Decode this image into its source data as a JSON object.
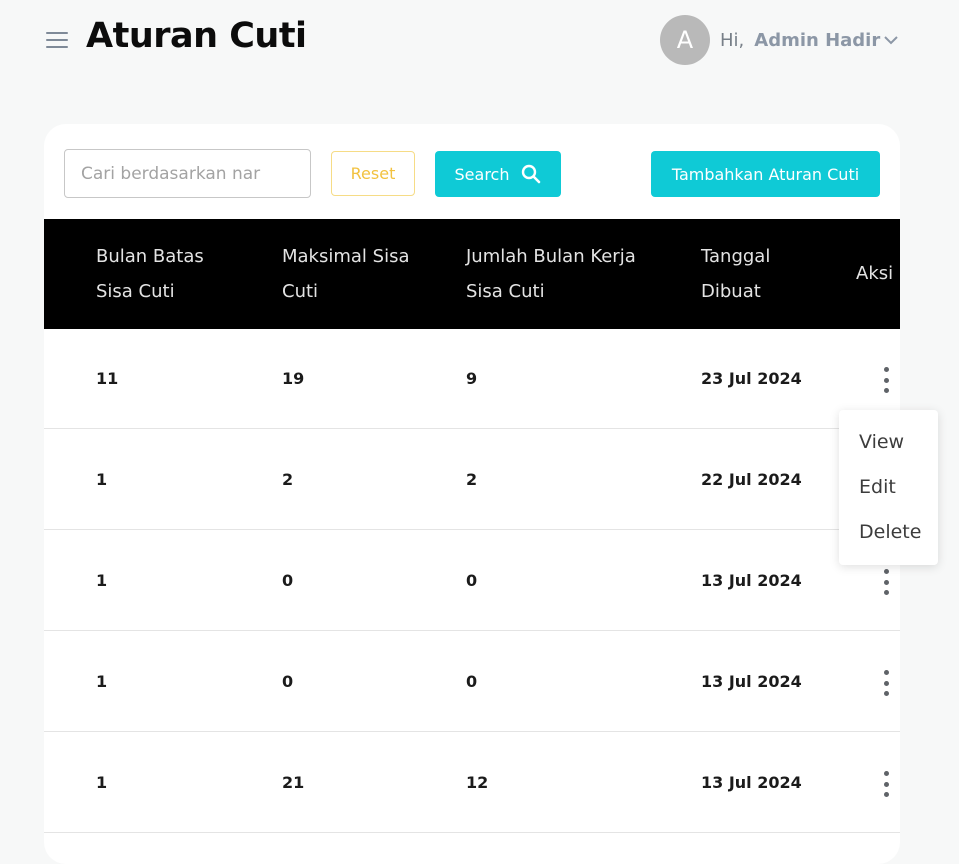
{
  "header": {
    "title": "Aturan Cuti",
    "avatar_initial": "A",
    "greeting": "Hi,",
    "user_name": "Admin Hadir"
  },
  "toolbar": {
    "search_placeholder": "Cari berdasarkan nar",
    "reset_label": "Reset",
    "search_label": "Search",
    "add_label": "Tambahkan Aturan Cuti"
  },
  "table": {
    "columns": [
      {
        "line1": "Bulan Batas",
        "line2": "Sisa Cuti"
      },
      {
        "line1": "Maksimal Sisa",
        "line2": "Cuti"
      },
      {
        "line1": "Jumlah Bulan Kerja",
        "line2": "Sisa Cuti"
      },
      {
        "line1": "Tanggal",
        "line2": "Dibuat"
      },
      {
        "line1": "Aksi",
        "line2": ""
      }
    ],
    "rows": [
      {
        "bulan_batas": "11",
        "maksimal": "19",
        "jumlah": "9",
        "tanggal": "23 Jul 2024"
      },
      {
        "bulan_batas": "1",
        "maksimal": "2",
        "jumlah": "2",
        "tanggal": "22 Jul 2024"
      },
      {
        "bulan_batas": "1",
        "maksimal": "0",
        "jumlah": "0",
        "tanggal": "13 Jul 2024"
      },
      {
        "bulan_batas": "1",
        "maksimal": "0",
        "jumlah": "0",
        "tanggal": "13 Jul 2024"
      },
      {
        "bulan_batas": "1",
        "maksimal": "21",
        "jumlah": "12",
        "tanggal": "13 Jul 2024"
      }
    ]
  },
  "action_menu": {
    "items": [
      "View",
      "Edit",
      "Delete"
    ]
  },
  "icons": {
    "menu": "hamburger-icon",
    "chevron": "chevron-down-icon",
    "search": "search-icon",
    "kebab": "more-vertical-icon"
  },
  "colors": {
    "accent": "#0fcad6",
    "reset": "#f2c240",
    "table_header": "#000000"
  }
}
